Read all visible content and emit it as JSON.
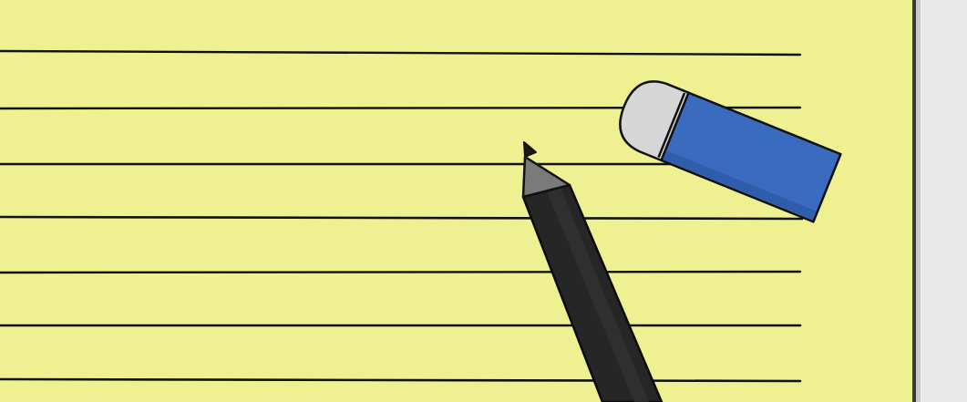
{
  "scene": {
    "paper_color": "#eef092",
    "backdrop_color": "#e9e9e9",
    "ink_color": "#111111",
    "ruled_line_count": 7,
    "objects": [
      {
        "name": "pencil-icon",
        "body_color": "#262626",
        "tip_color": "#7a7a7a",
        "point_color": "#1a1a1a"
      },
      {
        "name": "eraser-icon",
        "body_color": "#3a6bbf",
        "cap_color": "#d6d6d6"
      }
    ]
  }
}
